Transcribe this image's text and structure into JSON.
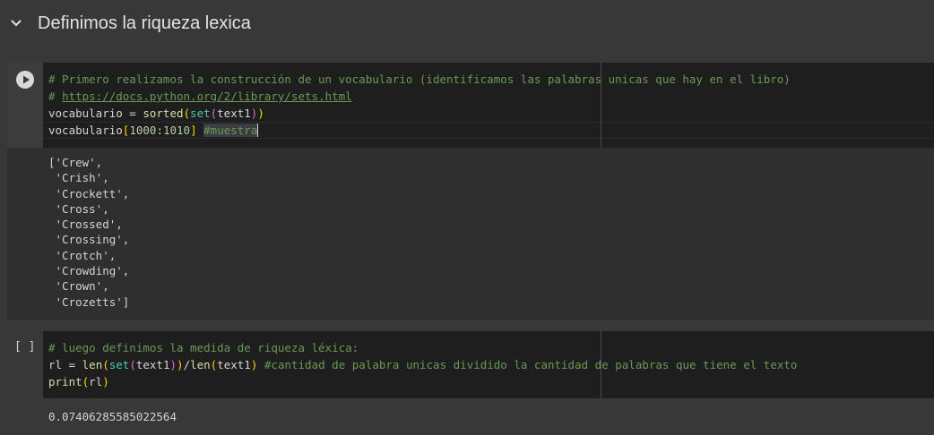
{
  "section": {
    "title": "Definimos la riqueza lexica",
    "icon": "chevron-down-icon"
  },
  "cell1": {
    "run_icon": "play-icon",
    "code": {
      "l1_comment": "# Primero realizamos la construcción de un vocabulario (identificamos las palabras unicas que hay en el libro)",
      "l2_hash": "# ",
      "l2_link": "https://docs.python.org/2/library/sets.html",
      "l3_a": "vocabulario = ",
      "l3_fn": "sorted",
      "l3_p1": "(",
      "l3_bi": "set",
      "l3_p2": "(",
      "l3_arg": "text1",
      "l3_p3": ")",
      "l3_p4": ")",
      "l4_a": "vocabulario",
      "l4_b1": "[",
      "l4_n1": "1000",
      "l4_colon": ":",
      "l4_n2": "1010",
      "l4_b2": "]",
      "l4_sp": " ",
      "l4_comment": "#muestra"
    },
    "output": "['Crew',\n 'Crish',\n 'Crockett',\n 'Cross',\n 'Crossed',\n 'Crossing',\n 'Crotch',\n 'Crowding',\n 'Crown',\n 'Crozetts']"
  },
  "cell2": {
    "execution_count": "[ ]",
    "code": {
      "l1_comment": "# luego definimos la medida de riqueza léxica:",
      "l2_a": "rl = ",
      "l2_len1": "len",
      "l2_p1": "(",
      "l2_set": "set",
      "l2_p2": "(",
      "l2_arg1": "text1",
      "l2_p3": ")",
      "l2_p4": ")",
      "l2_div": "/",
      "l2_len2": "len",
      "l2_p5": "(",
      "l2_arg2": "text1",
      "l2_p6": ")",
      "l2_sp": " ",
      "l2_comment": "#cantidad de palabra unicas dividido la cantidad de palabras que tiene el texto",
      "l3_print": "print",
      "l3_p1": "(",
      "l3_arg": "rl",
      "l3_p2": ")"
    },
    "output": "0.07406285585022564"
  }
}
